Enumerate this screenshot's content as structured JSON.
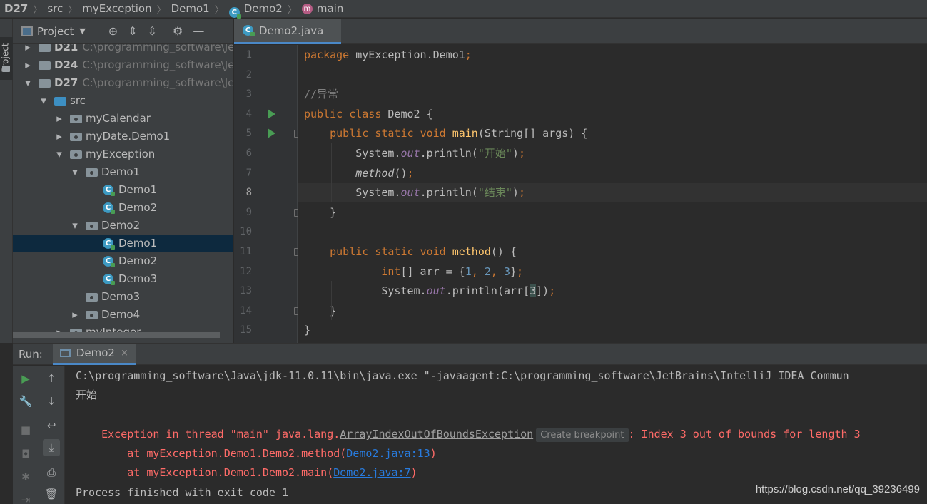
{
  "breadcrumb": {
    "items": [
      "D27",
      "src",
      "myException",
      "Demo1",
      "Demo2",
      "main"
    ],
    "separator": "〉"
  },
  "toolstrip": {
    "project_label": "Project"
  },
  "project_panel": {
    "title": "Project",
    "tree": [
      {
        "label": "D21",
        "path": "C:\\programming_software\\Jet",
        "level": 0,
        "arrow": "right",
        "kind": "module"
      },
      {
        "label": "D24",
        "path": "C:\\programming_software\\Jet",
        "level": 0,
        "arrow": "right",
        "kind": "module"
      },
      {
        "label": "D27",
        "path": "C:\\programming_software\\Jet",
        "level": 0,
        "arrow": "down",
        "kind": "module"
      },
      {
        "label": "src",
        "level": 1,
        "arrow": "down",
        "kind": "src-folder"
      },
      {
        "label": "myCalendar",
        "level": 2,
        "arrow": "right",
        "kind": "package"
      },
      {
        "label": "myDate.Demo1",
        "level": 2,
        "arrow": "right",
        "kind": "package"
      },
      {
        "label": "myException",
        "level": 2,
        "arrow": "down",
        "kind": "package"
      },
      {
        "label": "Demo1",
        "level": 3,
        "arrow": "down",
        "kind": "package"
      },
      {
        "label": "Demo1",
        "level": 4,
        "arrow": "none",
        "kind": "class"
      },
      {
        "label": "Demo2",
        "level": 4,
        "arrow": "none",
        "kind": "class"
      },
      {
        "label": "Demo2",
        "level": 3,
        "arrow": "down",
        "kind": "package"
      },
      {
        "label": "Demo1",
        "level": 4,
        "arrow": "none",
        "kind": "class",
        "selected": true
      },
      {
        "label": "Demo2",
        "level": 4,
        "arrow": "none",
        "kind": "class"
      },
      {
        "label": "Demo3",
        "level": 4,
        "arrow": "none",
        "kind": "class"
      },
      {
        "label": "Demo3",
        "level": 3,
        "arrow": "none",
        "kind": "package"
      },
      {
        "label": "Demo4",
        "level": 3,
        "arrow": "right",
        "kind": "package"
      },
      {
        "label": "myInteger",
        "level": 2,
        "arrow": "right",
        "kind": "package"
      }
    ]
  },
  "editor": {
    "tab_label": "Demo2.java",
    "current_line": 8,
    "lines": [
      {
        "n": "1",
        "t": "package myException.Demo1;"
      },
      {
        "n": "2",
        "t": ""
      },
      {
        "n": "3",
        "t": "//异常"
      },
      {
        "n": "4",
        "t": "public class Demo2 {"
      },
      {
        "n": "5",
        "t": "    public static void main(String[] args) {"
      },
      {
        "n": "6",
        "t": "        System.out.println(\"开始\");"
      },
      {
        "n": "7",
        "t": "        method();"
      },
      {
        "n": "8",
        "t": "        System.out.println(\"结束\");"
      },
      {
        "n": "9",
        "t": "    }"
      },
      {
        "n": "10",
        "t": ""
      },
      {
        "n": "11",
        "t": "    public static void method() {"
      },
      {
        "n": "12",
        "t": "            int[] arr = {1, 2, 3};"
      },
      {
        "n": "13",
        "t": "            System.out.println(arr[3]);"
      },
      {
        "n": "14",
        "t": "    }"
      },
      {
        "n": "15",
        "t": "}"
      }
    ]
  },
  "run": {
    "label": "Run:",
    "tab_label": "Demo2",
    "close_glyph": "×",
    "output": {
      "cmd": "C:\\programming_software\\Java\\jdk-11.0.11\\bin\\java.exe \"-javaagent:C:\\programming_software\\JetBrains\\IntelliJ IDEA Commun",
      "line1": "开始",
      "err_prefix": "Exception in thread \"main\" java.lang.",
      "err_class": "ArrayIndexOutOfBoundsException",
      "bp_label": "Create breakpoint",
      "err_suffix": ": Index 3 out of bounds for length 3",
      "st1_prefix": "    at myException.Demo1.Demo2.method(",
      "st1_link": "Demo2.java:13",
      "st1_suffix": ")",
      "st2_prefix": "    at myException.Demo1.Demo2.main(",
      "st2_link": "Demo2.java:7",
      "st2_suffix": ")",
      "finish": "Process finished with exit code 1"
    }
  },
  "watermark": "https://blog.csdn.net/qq_39236499",
  "colors": {
    "keyword": "#cc7832",
    "method": "#ffc66d",
    "string": "#6a8759",
    "number": "#6897bb",
    "error": "#ff6b68",
    "link": "#287bde",
    "accent": "#4a88c7"
  }
}
